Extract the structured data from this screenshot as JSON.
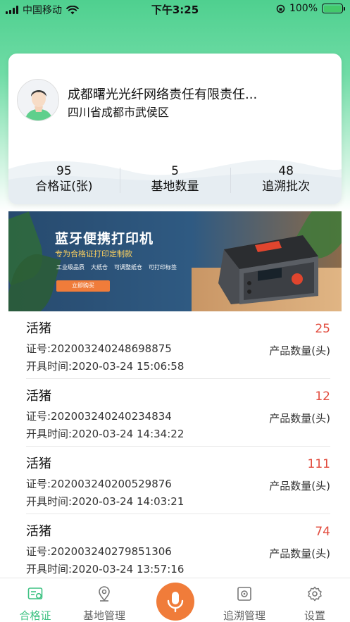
{
  "status_bar": {
    "carrier": "中国移动",
    "time": "下午3:25",
    "battery": "100%"
  },
  "profile": {
    "company": "成都曙光光纤网络责任有限责任...",
    "address": "四川省成都市武侯区",
    "stats": [
      {
        "value": "95",
        "label": "合格证(张)"
      },
      {
        "value": "5",
        "label": "基地数量"
      },
      {
        "value": "48",
        "label": "追溯批次"
      }
    ]
  },
  "banner": {
    "title": "蓝牙便携打印机",
    "subtitle": "专为合格证打印定制款",
    "tags": [
      "工业级品质",
      "大纸仓",
      "可调整纸仓",
      "可打印标签"
    ],
    "button": "立即购买"
  },
  "records": [
    {
      "name": "活猪",
      "cert": "证号:202003240248698875",
      "time": "开具时间:2020-03-24 15:06:58",
      "qty": "25",
      "qty_label": "产品数量(头)"
    },
    {
      "name": "活猪",
      "cert": "证号:202003240240234834",
      "time": "开具时间:2020-03-24 14:34:22",
      "qty": "12",
      "qty_label": "产品数量(头)"
    },
    {
      "name": "活猪",
      "cert": "证号:202003240200529876",
      "time": "开具时间:2020-03-24 14:03:21",
      "qty": "111",
      "qty_label": "产品数量(头)"
    },
    {
      "name": "活猪",
      "cert": "证号:202003240279851306",
      "time": "开具时间:2020-03-24 13:57:16",
      "qty": "74",
      "qty_label": "产品数量(头)"
    }
  ],
  "tabbar": {
    "tabs": [
      {
        "label": "合格证",
        "icon": "certificate-icon",
        "active": true
      },
      {
        "label": "基地管理",
        "icon": "location-pin-icon",
        "active": false
      },
      {
        "label": "",
        "icon": "microphone-icon",
        "active": false
      },
      {
        "label": "追溯管理",
        "icon": "trace-icon",
        "active": false
      },
      {
        "label": "设置",
        "icon": "gear-icon",
        "active": false
      }
    ]
  },
  "colors": {
    "accent": "#3fc283",
    "quantity": "#e24c3e",
    "mic_button": "#f07c3a"
  }
}
